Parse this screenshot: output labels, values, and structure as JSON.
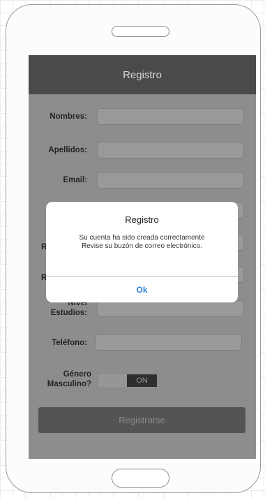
{
  "app": {
    "title": "Registro"
  },
  "form": {
    "fields": [
      {
        "label": "Nombres:",
        "value": ""
      },
      {
        "label": "Apellidos:",
        "value": ""
      },
      {
        "label": "Email:",
        "value": ""
      },
      {
        "label_fragment": "Re",
        "value": ""
      },
      {
        "label_fragment": "R",
        "value": ""
      },
      {
        "label": "Nivel Estudios:",
        "value": ""
      },
      {
        "label": "Teléfono:",
        "value": ""
      }
    ],
    "gender": {
      "label": "Género Masculino?",
      "toggle_text": "ON",
      "toggle_state": "on"
    },
    "submit_label": "Registrarse"
  },
  "dialog": {
    "title": "Registro",
    "message_line1": "Su cuenta ha sido creada correctamente",
    "message_line2": "Revise su buzón de correo electrónico.",
    "ok_label": "Ok"
  },
  "colors": {
    "appbar": "#4a4a4a",
    "dialog_button": "#2f86d4"
  }
}
